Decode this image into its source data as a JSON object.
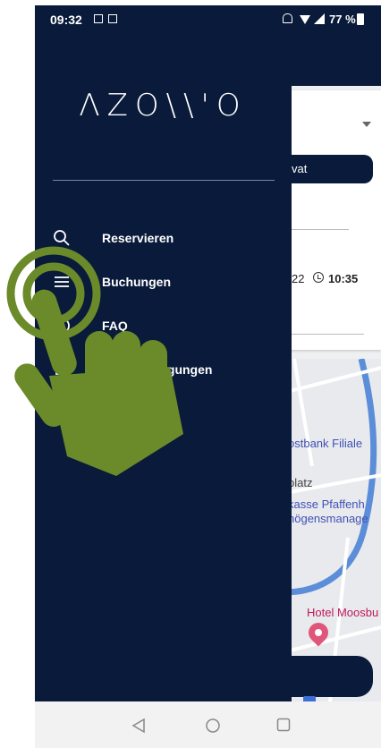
{
  "status_bar": {
    "time": "09:32",
    "battery": "77 %"
  },
  "logo": "ΛΖO\\\\'O",
  "menu": [
    {
      "label": "Reservieren",
      "icon": "search-icon"
    },
    {
      "label": "Buchungen",
      "icon": "list-icon"
    },
    {
      "label": "FAQ",
      "icon": "help-icon"
    },
    {
      "label": "Benachrichtigungen",
      "visible_fragment": "igungen",
      "icon": "bell-icon"
    }
  ],
  "background_app": {
    "pill_label": "vat",
    "date_fragment": "22",
    "time": "10:35",
    "map_labels": [
      {
        "text": "ostbank Filiale",
        "color": "#3f51b5"
      },
      {
        "text": "platz",
        "color": "#444444"
      },
      {
        "text": "kasse Pfaffenh",
        "color": "#3f51b5"
      },
      {
        "text": "högensmanage",
        "color": "#3f51b5"
      },
      {
        "text": "Hotel Moosbu",
        "color": "#c2185b"
      }
    ]
  },
  "nav_bar": {
    "buttons": [
      "back-icon",
      "home-icon",
      "recents-icon"
    ]
  },
  "overlay": {
    "icon": "tap-gesture-hand-icon",
    "color": "#6b8a2a"
  }
}
